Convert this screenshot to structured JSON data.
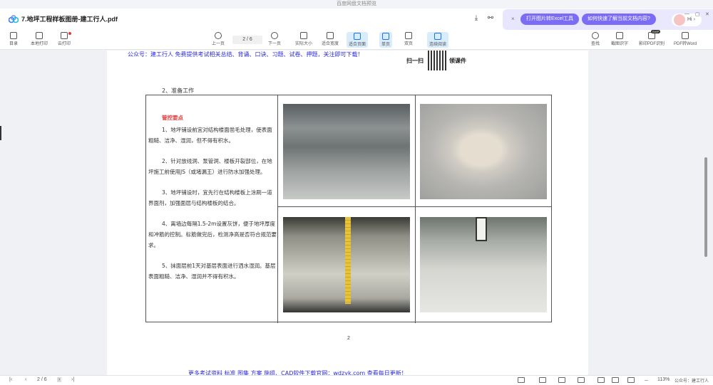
{
  "window": {
    "title": "百度网盘文档预览",
    "controls": [
      "minimize-icon",
      "restore-icon",
      "close-icon"
    ]
  },
  "header": {
    "filename": "7.地坪工程样板图册-建工行人.pdf",
    "icons": [
      "download-icon",
      "share-icon"
    ]
  },
  "ai_panel": {
    "close": "×",
    "btn_excel": "打开图片转Excel工具",
    "btn_ask": "如何快速了解当前文档内容?",
    "hi": "Hi"
  },
  "toolbar": {
    "left": [
      {
        "label": "目录",
        "icon": "outline-icon"
      },
      {
        "label": "本地打印",
        "icon": "print-icon"
      },
      {
        "label": "云打印",
        "icon": "cloud-print-icon"
      }
    ],
    "center": [
      {
        "label": "上一页",
        "icon": "prev-page-icon"
      },
      {
        "label": "下一页",
        "icon": "next-page-icon"
      },
      {
        "label": "实际大小",
        "icon": "actual-size-icon"
      },
      {
        "label": "适合宽度",
        "icon": "fit-width-icon"
      },
      {
        "label": "适合页面",
        "icon": "fit-page-icon"
      },
      {
        "label": "单页",
        "icon": "single-page-icon"
      },
      {
        "label": "双页",
        "icon": "double-page-icon"
      },
      {
        "label": "连续阅读",
        "icon": "continuous-icon"
      }
    ],
    "page_indicator": "2 / 6",
    "right": [
      {
        "label": "查找",
        "icon": "search-icon"
      },
      {
        "label": "截图识字",
        "icon": "ocr-icon"
      },
      {
        "label": "影印PDF识别",
        "icon": "scan-pdf-icon",
        "badge": "SVIP"
      },
      {
        "label": "PDF转Word",
        "icon": "pdf-to-word-icon"
      }
    ]
  },
  "document": {
    "banner_top": "公众号：建工行人  免费提供考试相关总结、背诵、口诀、习题、试卷、押题，关注即可下载！",
    "qr_left": "扫一扫",
    "qr_right": "领课件",
    "section_title": "2、准备工作",
    "table": {
      "heading": "管控要点",
      "points": [
        "1、地坪铺设前宜对结构楼面凿毛处理，使表面粗糙、洁净、湿润，但不得有积水。",
        "2、针对放线洞、泵管洞、楼板开裂部位，在地坪施工前使用JS（或堵漏王）进行防水加强处理。",
        "3、地坪铺设时，宜先行在结构楼板上涂刷一道界面剂，加强面层与结构楼板的结合。",
        "4、离墙边每隔1.5-2m设置灰饼，便于地坪厚度和冲筋的控制。标筋做完后，检测净高是否符合规范要求。",
        "5、抹面层前1天对基层表面进行洒水湿润。基层表面粗糙、洁净、湿润并不得有积水。"
      ]
    },
    "page_number": "2",
    "banner_bottom": "更多考试资料  标准  图集  方案  施组、CAD软件下载官网：wdzyk.com  查看每日更新！"
  },
  "footer": {
    "page_indicator": "2 / 6",
    "zoom": "113%",
    "watermark": "公众号：建工行人"
  }
}
